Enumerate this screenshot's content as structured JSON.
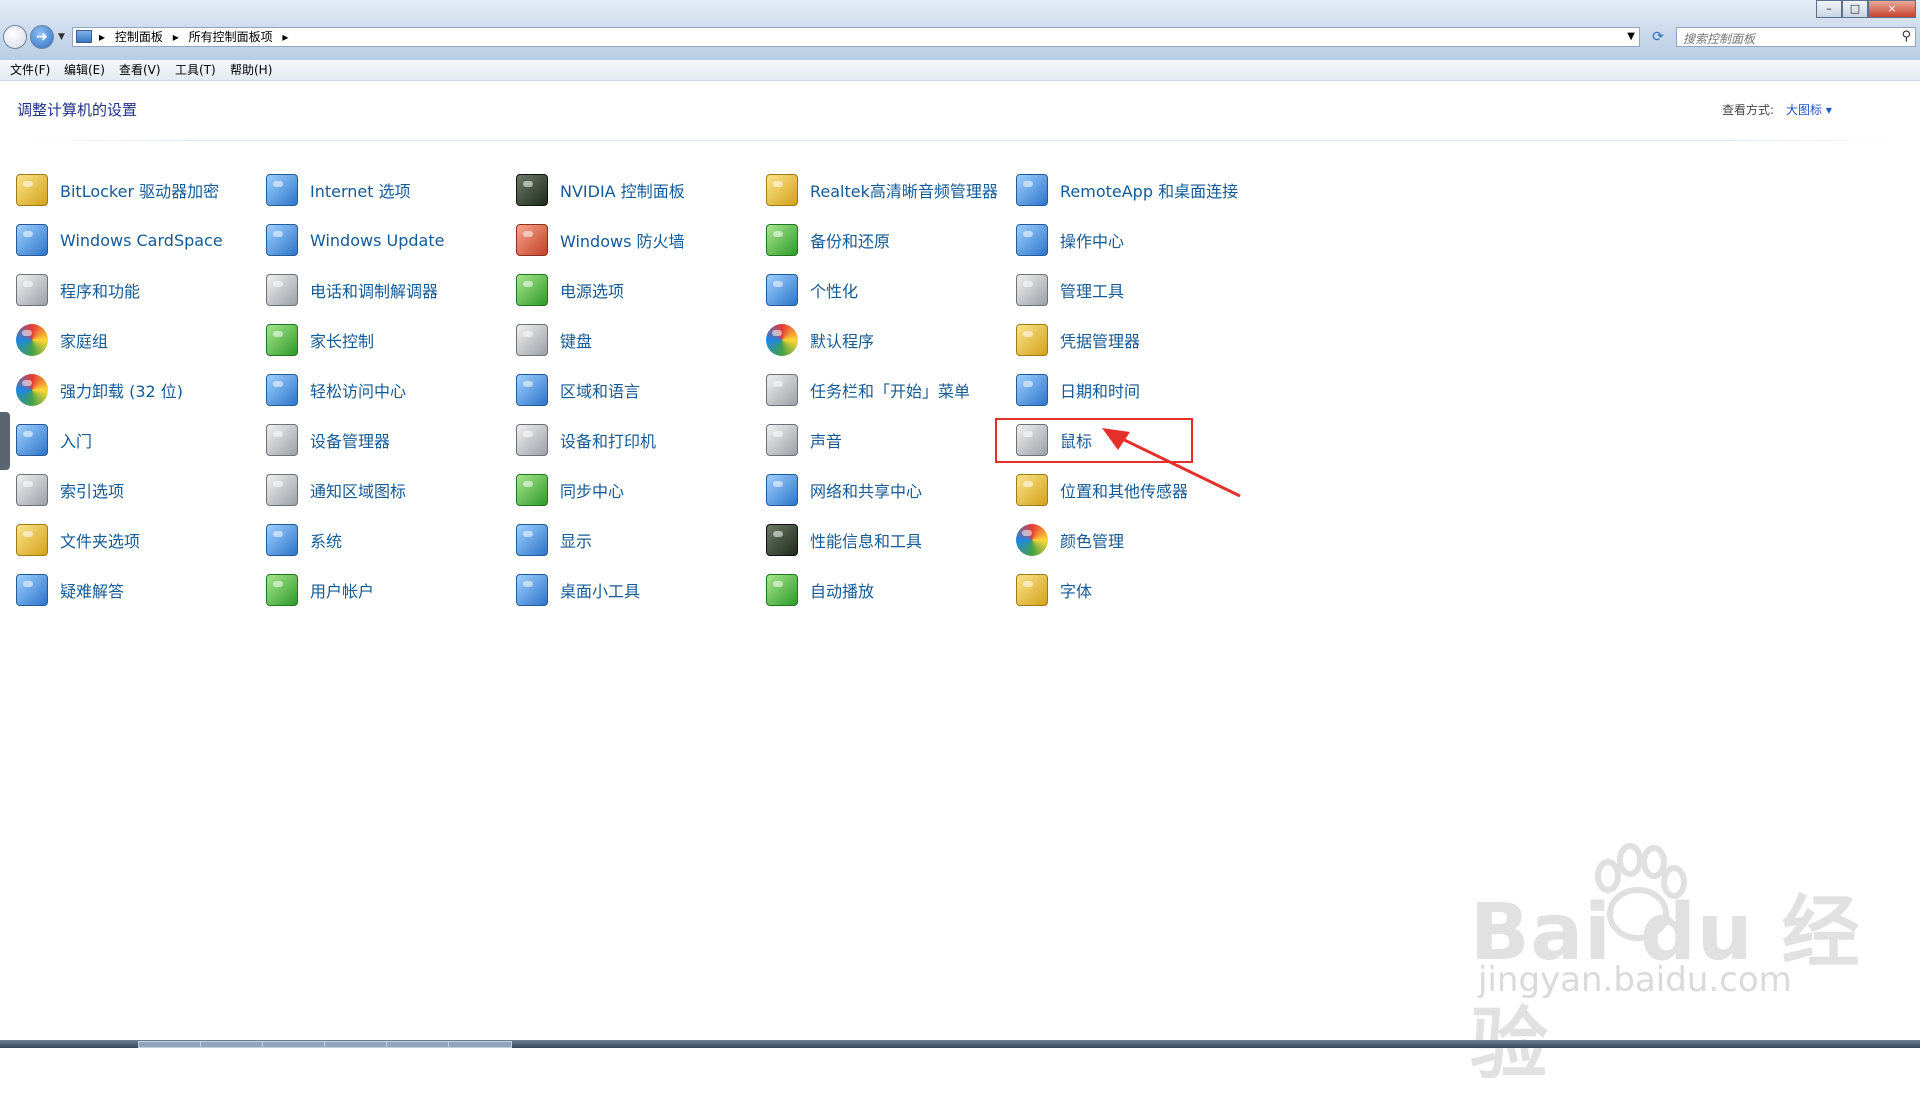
{
  "window": {
    "breadcrumbs": [
      "控制面板",
      "所有控制面板项"
    ],
    "search_placeholder": "搜索控制面板",
    "controls": {
      "minimize": "–",
      "maximize": "□",
      "close": "×"
    }
  },
  "menu": [
    "文件(F)",
    "编辑(E)",
    "查看(V)",
    "工具(T)",
    "帮助(H)"
  ],
  "content": {
    "title": "调整计算机的设置",
    "view_by_label": "查看方式:",
    "view_by_value": "大图标 ▾"
  },
  "columns": [
    [
      {
        "label": "BitLocker 驱动器加密",
        "icon": "bitlocker-key-icon",
        "color": "c-yellow"
      },
      {
        "label": "Windows CardSpace",
        "icon": "cardspace-icon",
        "color": "c-blue"
      },
      {
        "label": "程序和功能",
        "icon": "programs-icon",
        "color": "c-gray"
      },
      {
        "label": "家庭组",
        "icon": "homegroup-icon",
        "color": "c-multi"
      },
      {
        "label": "强力卸载 (32 位)",
        "icon": "uninstaller-icon",
        "color": "c-multi"
      },
      {
        "label": "入门",
        "icon": "getting-started-icon",
        "color": "c-blue"
      },
      {
        "label": "索引选项",
        "icon": "indexing-icon",
        "color": "c-gray"
      },
      {
        "label": "文件夹选项",
        "icon": "folder-options-icon",
        "color": "c-yellow"
      },
      {
        "label": "疑难解答",
        "icon": "troubleshooting-icon",
        "color": "c-blue"
      }
    ],
    [
      {
        "label": "Internet 选项",
        "icon": "internet-options-icon",
        "color": "c-blue"
      },
      {
        "label": "Windows Update",
        "icon": "windows-update-icon",
        "color": "c-blue"
      },
      {
        "label": "电话和调制解调器",
        "icon": "phone-modem-icon",
        "color": "c-gray"
      },
      {
        "label": "家长控制",
        "icon": "parental-controls-icon",
        "color": "c-green"
      },
      {
        "label": "轻松访问中心",
        "icon": "ease-of-access-icon",
        "color": "c-blue"
      },
      {
        "label": "设备管理器",
        "icon": "device-manager-icon",
        "color": "c-gray"
      },
      {
        "label": "通知区域图标",
        "icon": "notification-area-icon",
        "color": "c-gray"
      },
      {
        "label": "系统",
        "icon": "system-icon",
        "color": "c-blue"
      },
      {
        "label": "用户帐户",
        "icon": "user-accounts-icon",
        "color": "c-green"
      }
    ],
    [
      {
        "label": "NVIDIA 控制面板",
        "icon": "nvidia-icon",
        "color": "c-dark"
      },
      {
        "label": "Windows 防火墙",
        "icon": "firewall-icon",
        "color": "c-red"
      },
      {
        "label": "电源选项",
        "icon": "power-options-icon",
        "color": "c-green"
      },
      {
        "label": "键盘",
        "icon": "keyboard-icon",
        "color": "c-gray"
      },
      {
        "label": "区域和语言",
        "icon": "region-language-icon",
        "color": "c-blue"
      },
      {
        "label": "设备和打印机",
        "icon": "devices-printers-icon",
        "color": "c-gray"
      },
      {
        "label": "同步中心",
        "icon": "sync-center-icon",
        "color": "c-green"
      },
      {
        "label": "显示",
        "icon": "display-icon",
        "color": "c-blue"
      },
      {
        "label": "桌面小工具",
        "icon": "desktop-gadgets-icon",
        "color": "c-blue"
      }
    ],
    [
      {
        "label": "Realtek高清晰音频管理器",
        "icon": "realtek-audio-icon",
        "color": "c-yellow"
      },
      {
        "label": "备份和还原",
        "icon": "backup-restore-icon",
        "color": "c-green"
      },
      {
        "label": "个性化",
        "icon": "personalization-icon",
        "color": "c-blue"
      },
      {
        "label": "默认程序",
        "icon": "default-programs-icon",
        "color": "c-multi"
      },
      {
        "label": "任务栏和「开始」菜单",
        "icon": "taskbar-start-menu-icon",
        "color": "c-gray"
      },
      {
        "label": "声音",
        "icon": "sound-icon",
        "color": "c-gray"
      },
      {
        "label": "网络和共享中心",
        "icon": "network-sharing-icon",
        "color": "c-blue"
      },
      {
        "label": "性能信息和工具",
        "icon": "performance-icon",
        "color": "c-dark"
      },
      {
        "label": "自动播放",
        "icon": "autoplay-icon",
        "color": "c-green"
      }
    ],
    [
      {
        "label": "RemoteApp 和桌面连接",
        "icon": "remoteapp-icon",
        "color": "c-blue"
      },
      {
        "label": "操作中心",
        "icon": "action-center-flag-icon",
        "color": "c-blue"
      },
      {
        "label": "管理工具",
        "icon": "administrative-tools-icon",
        "color": "c-gray"
      },
      {
        "label": "凭据管理器",
        "icon": "credential-manager-icon",
        "color": "c-yellow"
      },
      {
        "label": "日期和时间",
        "icon": "date-time-icon",
        "color": "c-blue"
      },
      {
        "label": "鼠标",
        "icon": "mouse-icon",
        "color": "c-gray"
      },
      {
        "label": "位置和其他传感器",
        "icon": "location-sensors-icon",
        "color": "c-yellow"
      },
      {
        "label": "颜色管理",
        "icon": "color-management-icon",
        "color": "c-multi"
      },
      {
        "label": "字体",
        "icon": "fonts-icon",
        "color": "c-yellow"
      }
    ]
  ],
  "watermark": {
    "line1": "Bai du 经验",
    "line2": "jingyan.baidu.com"
  }
}
